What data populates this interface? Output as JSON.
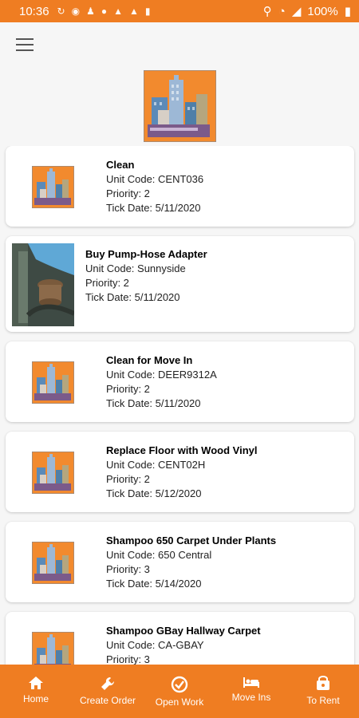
{
  "status": {
    "time": "10:36",
    "battery": "100%"
  },
  "colors": {
    "accent": "#ef7d22",
    "building_bg": "#f28a2e"
  },
  "tasks": [
    {
      "title": "Clean",
      "unit": "Unit Code: CENT036",
      "priority": "Priority: 2",
      "date": "Tick Date: 5/11/2020",
      "thumb": "building-icon"
    },
    {
      "title": "Buy Pump-Hose Adapter",
      "unit": "Unit Code: Sunnyside",
      "priority": "Priority: 2",
      "date": "Tick Date: 5/11/2020",
      "thumb": "photo"
    },
    {
      "title": "Clean for Move In",
      "unit": "Unit Code: DEER9312A",
      "priority": "Priority: 2",
      "date": "Tick Date: 5/11/2020",
      "thumb": "building-icon"
    },
    {
      "title": "Replace Floor with Wood Vinyl",
      "unit": "Unit Code: CENT02H",
      "priority": "Priority: 2",
      "date": "Tick Date: 5/12/2020",
      "thumb": "building-icon"
    },
    {
      "title": "Shampoo 650 Carpet Under Plants",
      "unit": "Unit Code: 650 Central",
      "priority": "Priority: 3",
      "date": "Tick Date: 5/14/2020",
      "thumb": "building-icon"
    },
    {
      "title": "Shampoo GBay Hallway Carpet",
      "unit": "Unit Code: CA-GBAY",
      "priority": "Priority: 3",
      "date": "",
      "thumb": "building-icon"
    }
  ],
  "nav": [
    {
      "label": "Home",
      "icon": "home-icon"
    },
    {
      "label": "Create Order",
      "icon": "wrench-icon"
    },
    {
      "label": "Open Work",
      "icon": "check-circle-icon"
    },
    {
      "label": "Move Ins",
      "icon": "bed-icon"
    },
    {
      "label": "To Rent",
      "icon": "key-icon"
    }
  ]
}
